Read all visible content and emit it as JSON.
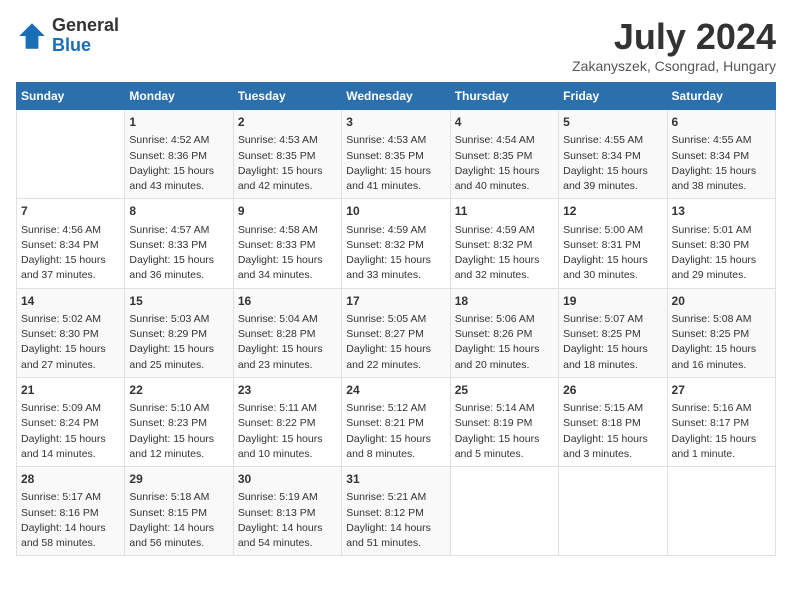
{
  "header": {
    "logo_general": "General",
    "logo_blue": "Blue",
    "month_year": "July 2024",
    "location": "Zakanyszek, Csongrad, Hungary"
  },
  "days_of_week": [
    "Sunday",
    "Monday",
    "Tuesday",
    "Wednesday",
    "Thursday",
    "Friday",
    "Saturday"
  ],
  "weeks": [
    [
      {
        "day": "",
        "content": ""
      },
      {
        "day": "1",
        "content": "Sunrise: 4:52 AM\nSunset: 8:36 PM\nDaylight: 15 hours\nand 43 minutes."
      },
      {
        "day": "2",
        "content": "Sunrise: 4:53 AM\nSunset: 8:35 PM\nDaylight: 15 hours\nand 42 minutes."
      },
      {
        "day": "3",
        "content": "Sunrise: 4:53 AM\nSunset: 8:35 PM\nDaylight: 15 hours\nand 41 minutes."
      },
      {
        "day": "4",
        "content": "Sunrise: 4:54 AM\nSunset: 8:35 PM\nDaylight: 15 hours\nand 40 minutes."
      },
      {
        "day": "5",
        "content": "Sunrise: 4:55 AM\nSunset: 8:34 PM\nDaylight: 15 hours\nand 39 minutes."
      },
      {
        "day": "6",
        "content": "Sunrise: 4:55 AM\nSunset: 8:34 PM\nDaylight: 15 hours\nand 38 minutes."
      }
    ],
    [
      {
        "day": "7",
        "content": "Sunrise: 4:56 AM\nSunset: 8:34 PM\nDaylight: 15 hours\nand 37 minutes."
      },
      {
        "day": "8",
        "content": "Sunrise: 4:57 AM\nSunset: 8:33 PM\nDaylight: 15 hours\nand 36 minutes."
      },
      {
        "day": "9",
        "content": "Sunrise: 4:58 AM\nSunset: 8:33 PM\nDaylight: 15 hours\nand 34 minutes."
      },
      {
        "day": "10",
        "content": "Sunrise: 4:59 AM\nSunset: 8:32 PM\nDaylight: 15 hours\nand 33 minutes."
      },
      {
        "day": "11",
        "content": "Sunrise: 4:59 AM\nSunset: 8:32 PM\nDaylight: 15 hours\nand 32 minutes."
      },
      {
        "day": "12",
        "content": "Sunrise: 5:00 AM\nSunset: 8:31 PM\nDaylight: 15 hours\nand 30 minutes."
      },
      {
        "day": "13",
        "content": "Sunrise: 5:01 AM\nSunset: 8:30 PM\nDaylight: 15 hours\nand 29 minutes."
      }
    ],
    [
      {
        "day": "14",
        "content": "Sunrise: 5:02 AM\nSunset: 8:30 PM\nDaylight: 15 hours\nand 27 minutes."
      },
      {
        "day": "15",
        "content": "Sunrise: 5:03 AM\nSunset: 8:29 PM\nDaylight: 15 hours\nand 25 minutes."
      },
      {
        "day": "16",
        "content": "Sunrise: 5:04 AM\nSunset: 8:28 PM\nDaylight: 15 hours\nand 23 minutes."
      },
      {
        "day": "17",
        "content": "Sunrise: 5:05 AM\nSunset: 8:27 PM\nDaylight: 15 hours\nand 22 minutes."
      },
      {
        "day": "18",
        "content": "Sunrise: 5:06 AM\nSunset: 8:26 PM\nDaylight: 15 hours\nand 20 minutes."
      },
      {
        "day": "19",
        "content": "Sunrise: 5:07 AM\nSunset: 8:25 PM\nDaylight: 15 hours\nand 18 minutes."
      },
      {
        "day": "20",
        "content": "Sunrise: 5:08 AM\nSunset: 8:25 PM\nDaylight: 15 hours\nand 16 minutes."
      }
    ],
    [
      {
        "day": "21",
        "content": "Sunrise: 5:09 AM\nSunset: 8:24 PM\nDaylight: 15 hours\nand 14 minutes."
      },
      {
        "day": "22",
        "content": "Sunrise: 5:10 AM\nSunset: 8:23 PM\nDaylight: 15 hours\nand 12 minutes."
      },
      {
        "day": "23",
        "content": "Sunrise: 5:11 AM\nSunset: 8:22 PM\nDaylight: 15 hours\nand 10 minutes."
      },
      {
        "day": "24",
        "content": "Sunrise: 5:12 AM\nSunset: 8:21 PM\nDaylight: 15 hours\nand 8 minutes."
      },
      {
        "day": "25",
        "content": "Sunrise: 5:14 AM\nSunset: 8:19 PM\nDaylight: 15 hours\nand 5 minutes."
      },
      {
        "day": "26",
        "content": "Sunrise: 5:15 AM\nSunset: 8:18 PM\nDaylight: 15 hours\nand 3 minutes."
      },
      {
        "day": "27",
        "content": "Sunrise: 5:16 AM\nSunset: 8:17 PM\nDaylight: 15 hours\nand 1 minute."
      }
    ],
    [
      {
        "day": "28",
        "content": "Sunrise: 5:17 AM\nSunset: 8:16 PM\nDaylight: 14 hours\nand 58 minutes."
      },
      {
        "day": "29",
        "content": "Sunrise: 5:18 AM\nSunset: 8:15 PM\nDaylight: 14 hours\nand 56 minutes."
      },
      {
        "day": "30",
        "content": "Sunrise: 5:19 AM\nSunset: 8:13 PM\nDaylight: 14 hours\nand 54 minutes."
      },
      {
        "day": "31",
        "content": "Sunrise: 5:21 AM\nSunset: 8:12 PM\nDaylight: 14 hours\nand 51 minutes."
      },
      {
        "day": "",
        "content": ""
      },
      {
        "day": "",
        "content": ""
      },
      {
        "day": "",
        "content": ""
      }
    ]
  ]
}
